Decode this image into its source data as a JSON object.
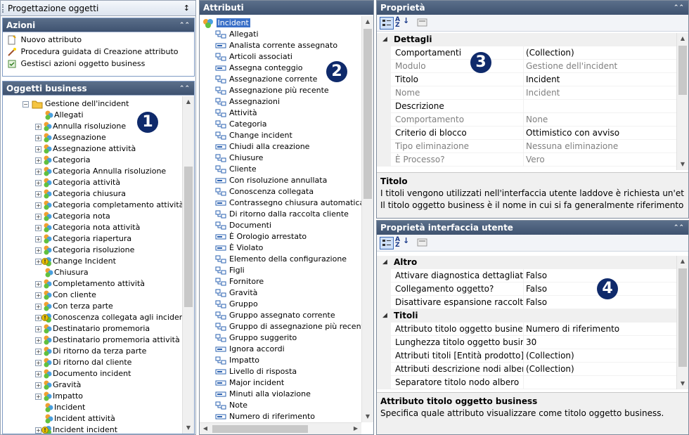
{
  "left": {
    "title": "Progettazione oggetti",
    "azioni": {
      "title": "Azioni",
      "items": [
        {
          "label": "Nuovo attributo",
          "icon": "new-document-icon"
        },
        {
          "label": "Procedura guidata di Creazione attributo",
          "icon": "wizard-icon"
        },
        {
          "label": "Gestisci azioni oggetto business",
          "icon": "actions-icon"
        }
      ]
    },
    "oggetti": {
      "title": "Oggetti business",
      "root": "Gestione dell'incident",
      "badge": "1",
      "items": [
        {
          "label": "Allegati",
          "exp": false,
          "warn": false
        },
        {
          "label": "Annulla risoluzione",
          "exp": true,
          "warn": false
        },
        {
          "label": "Assegnazione",
          "exp": true,
          "warn": false
        },
        {
          "label": "Assegnazione attività",
          "exp": true,
          "warn": false
        },
        {
          "label": "Categoria",
          "exp": true,
          "warn": false
        },
        {
          "label": "Categoria Annulla risoluzione",
          "exp": true,
          "warn": false
        },
        {
          "label": "Categoria attività",
          "exp": true,
          "warn": false
        },
        {
          "label": "Categoria chiusura",
          "exp": true,
          "warn": false
        },
        {
          "label": "Categoria completamento attività",
          "exp": true,
          "warn": false
        },
        {
          "label": "Categoria nota",
          "exp": true,
          "warn": false
        },
        {
          "label": "Categoria nota attività",
          "exp": true,
          "warn": false
        },
        {
          "label": "Categoria riapertura",
          "exp": true,
          "warn": false
        },
        {
          "label": "Categoria risoluzione",
          "exp": true,
          "warn": false
        },
        {
          "label": "Change Incident",
          "exp": true,
          "warn": true
        },
        {
          "label": "Chiusura",
          "exp": false,
          "warn": false
        },
        {
          "label": "Completamento attività",
          "exp": true,
          "warn": false
        },
        {
          "label": "Con cliente",
          "exp": true,
          "warn": false
        },
        {
          "label": "Con terza parte",
          "exp": true,
          "warn": false
        },
        {
          "label": "Conoscenza collegata agli incident",
          "exp": true,
          "warn": true
        },
        {
          "label": "Destinatario promemoria",
          "exp": true,
          "warn": false
        },
        {
          "label": "Destinatario promemoria attività",
          "exp": true,
          "warn": false
        },
        {
          "label": "Di ritorno da terza parte",
          "exp": true,
          "warn": false
        },
        {
          "label": "Di ritorno dal cliente",
          "exp": true,
          "warn": false
        },
        {
          "label": "Documento incident",
          "exp": true,
          "warn": false
        },
        {
          "label": "Gravità",
          "exp": true,
          "warn": false
        },
        {
          "label": "Impatto",
          "exp": true,
          "warn": false
        },
        {
          "label": "Incident",
          "exp": false,
          "warn": false
        },
        {
          "label": "Incident attività",
          "exp": false,
          "warn": false
        },
        {
          "label": "Incident incident",
          "exp": true,
          "warn": true
        }
      ]
    }
  },
  "attributi": {
    "title": "Attributi",
    "root": "Incident",
    "badge": "2",
    "items": [
      "Allegati",
      "Analista corrente assegnato",
      "Articoli associati",
      "Assegna conteggio",
      "Assegnazione corrente",
      "Assegnazione più recente",
      "Assegnazioni",
      "Attività",
      "Categoria",
      "Change incident",
      "Chiudi alla creazione",
      "Chiusure",
      "Cliente",
      "Con risoluzione annullata",
      "Conoscenza collegata",
      "Contrassegno chiusura automatica",
      "Di ritorno dalla raccolta cliente",
      "Documenti",
      "È Orologio arrestato",
      "È Violato",
      "Elemento della configurazione",
      "Figli",
      "Fornitore",
      "Gravità",
      "Gruppo",
      "Gruppo assegnato corrente",
      "Gruppo di assegnazione più recente",
      "Gruppo suggerito",
      "Ignora accordi",
      "Impatto",
      "Livello di risposta",
      "Major incident",
      "Minuti alla violazione",
      "Note",
      "Numero di riferimento"
    ],
    "icon_types": [
      "link",
      "field",
      "link",
      "field",
      "link",
      "link",
      "link",
      "link",
      "link",
      "link",
      "field",
      "link",
      "link",
      "field",
      "link",
      "field",
      "link",
      "link",
      "field",
      "field",
      "link",
      "link",
      "link",
      "link",
      "link",
      "link",
      "link",
      "link",
      "field",
      "link",
      "field",
      "field",
      "field",
      "link",
      "field"
    ]
  },
  "proprieta": {
    "title": "Proprietà",
    "badge": "3",
    "category": "Dettagli",
    "rows": [
      {
        "k": "Comportamenti",
        "v": "(Collection)",
        "gray": false
      },
      {
        "k": "Modulo",
        "v": "Gestione dell'incident",
        "gray": true
      },
      {
        "k": "Titolo",
        "v": "Incident",
        "gray": false
      },
      {
        "k": "Nome",
        "v": "Incident",
        "gray": true
      },
      {
        "k": "Descrizione",
        "v": "",
        "gray": false
      },
      {
        "k": "Comportamento",
        "v": "None",
        "gray": true
      },
      {
        "k": "Criterio di blocco",
        "v": "Ottimistico con avviso",
        "gray": false
      },
      {
        "k": "Tipo eliminazione",
        "v": "Nessuna eliminazione",
        "gray": true
      },
      {
        "k": "È Processo?",
        "v": "Vero",
        "gray": true
      }
    ],
    "desc_title": "Titolo",
    "desc_line1": "I titoli vengono utilizzati nell'interfaccia utente laddove è richiesta un'etichetta.",
    "desc_line2": "Il titolo oggetto business è il nome in cui si fa generalmente riferimento all'og..."
  },
  "ui": {
    "title": "Proprietà interfaccia utente",
    "badge": "4",
    "cat1": "Altro",
    "rows1": [
      {
        "k": "Attivare diagnostica dettagliata?",
        "v": "Falso"
      },
      {
        "k": "Collegamento oggetto?",
        "v": "Falso"
      },
      {
        "k": "Disattivare espansione raccolte?",
        "v": "Falso"
      }
    ],
    "cat2": "Titoli",
    "rows2": [
      {
        "k": "Attributo titolo oggetto business",
        "v": "Numero di riferimento"
      },
      {
        "k": "Lunghezza titolo oggetto business",
        "v": "30"
      },
      {
        "k": "Attributi titoli [Entità prodotto]",
        "v": "(Collection)"
      },
      {
        "k": "Attributi descrizione nodi albero",
        "v": "(Collection)"
      },
      {
        "k": "Separatore titolo nodo albero",
        "v": ""
      }
    ],
    "desc_title": "Attributo titolo oggetto business",
    "desc_line1": "Specifica quale attributo visualizzare come titolo oggetto business."
  }
}
